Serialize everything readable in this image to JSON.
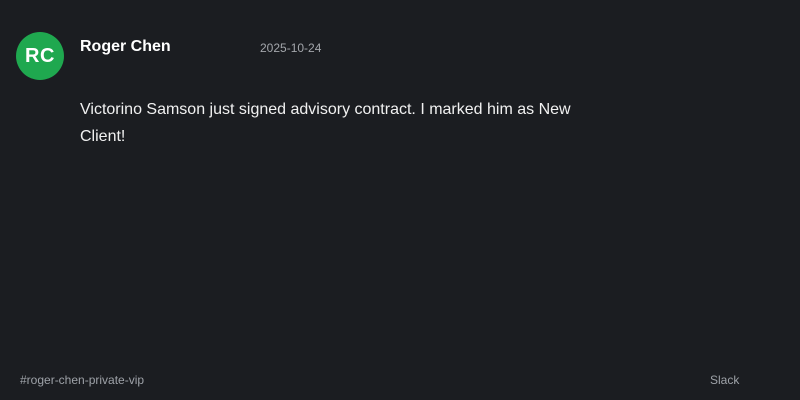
{
  "message": {
    "avatar_initials": "RC",
    "author": "Roger Chen",
    "timestamp": "2025-10-24",
    "text": "Victorino Samson just signed advisory contract. I marked him as New Client!"
  },
  "footer": {
    "channel": "#roger-chen-private-vip",
    "app": "Slack"
  },
  "colors": {
    "background": "#1b1d21",
    "avatar_bg": "#1fa84f",
    "primary_text": "#ffffff",
    "secondary_text": "#a3a6ab"
  }
}
